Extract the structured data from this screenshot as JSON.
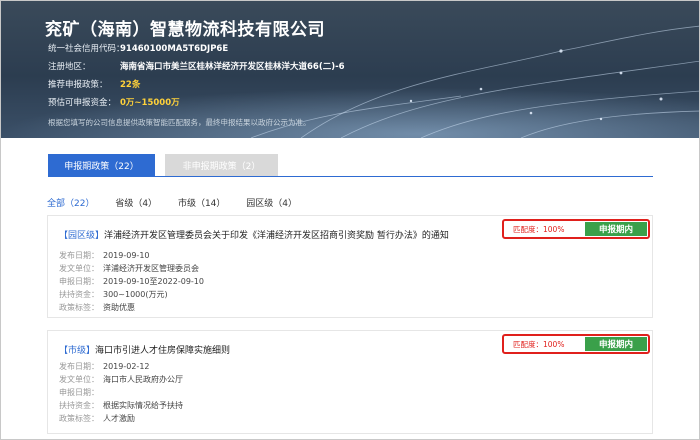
{
  "company": {
    "name": "兖矿（海南）智慧物流科技有限公司",
    "credit_code_label": "统一社会信用代码：",
    "credit_code": "91460100MA5T6DJP6E",
    "address_label": "注册地区：",
    "address": "海南省海口市美兰区桂林洋经济开发区桂林洋大道66(二)-6",
    "policies_label": "推荐申报政策：",
    "policies_count": "22条",
    "funds_label": "预估可申报资金：",
    "funds_range": "0万~15000万",
    "disclaimer": "根据您填写的公司信息提供政策智能匹配服务，最终申报结果以政府公示为准。"
  },
  "tabs": {
    "active_label": "申报期政策（22）",
    "inactive_label": "非申报期政策（2）"
  },
  "filters": [
    "全部（22）",
    "省级（4）",
    "市级（14）",
    "园区级（4）"
  ],
  "policies": [
    {
      "level": "【园区级】",
      "title": "洋浦经济开发区管理委员会关于印发《洋浦经济开发区招商引资奖励 暂行办法》的通知",
      "match_label": "匹配度：100%",
      "status": "申报期内",
      "fields": [
        {
          "k": "发布日期：",
          "v": "2019-09-10"
        },
        {
          "k": "发文单位：",
          "v": "洋浦经济开发区管理委员会"
        },
        {
          "k": "申报日期：",
          "v": "2019-09-10至2022-09-10"
        },
        {
          "k": "扶持资金：",
          "v": "300~1000(万元)"
        },
        {
          "k": "政策标签：",
          "v": "资助优惠"
        }
      ]
    },
    {
      "level": "【市级】",
      "title": "海口市引进人才住房保障实施细则",
      "match_label": "匹配度：100%",
      "status": "申报期内",
      "fields": [
        {
          "k": "发布日期：",
          "v": "2019-02-12"
        },
        {
          "k": "发文单位：",
          "v": "海口市人民政府办公厅"
        },
        {
          "k": "申报日期：",
          "v": ""
        },
        {
          "k": "扶持资金：",
          "v": "根据实际情况给予扶持"
        },
        {
          "k": "政策标签：",
          "v": "人才激励"
        }
      ]
    }
  ],
  "colors": {
    "accent_blue": "#2e6bd2",
    "highlight_yellow": "#ffd23a",
    "match_red": "#e0201c",
    "status_green": "#3aa04a",
    "banner_dark": "#2c3d50"
  }
}
